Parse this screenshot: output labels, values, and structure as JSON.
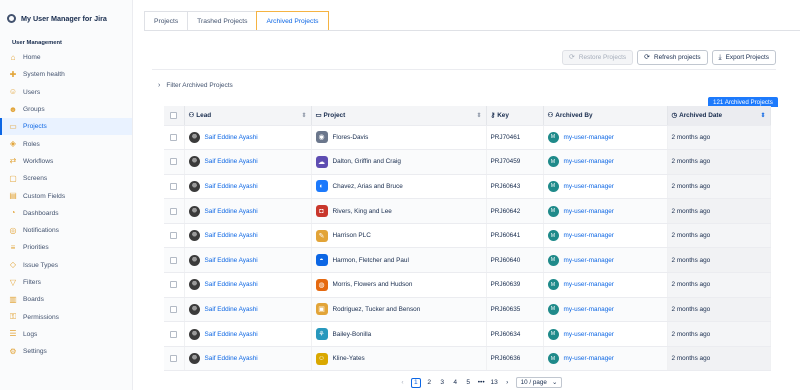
{
  "app": {
    "title": "My User Manager for Jira"
  },
  "sidebar": {
    "section_title": "User Management",
    "items": [
      {
        "label": "Home",
        "icon": "home-icon",
        "glyph": "⌂",
        "name": "home"
      },
      {
        "label": "System health",
        "icon": "health-icon",
        "glyph": "✚",
        "name": "system-health"
      },
      {
        "label": "Users",
        "icon": "user-icon",
        "glyph": "☺",
        "name": "users"
      },
      {
        "label": "Groups",
        "icon": "group-icon",
        "glyph": "☻",
        "name": "groups"
      },
      {
        "label": "Projects",
        "icon": "folder-icon",
        "glyph": "▭",
        "name": "projects",
        "active": true
      },
      {
        "label": "Roles",
        "icon": "role-icon",
        "glyph": "◈",
        "name": "roles"
      },
      {
        "label": "Workflows",
        "icon": "workflow-icon",
        "glyph": "⇄",
        "name": "workflows"
      },
      {
        "label": "Screens",
        "icon": "screen-icon",
        "glyph": "▢",
        "name": "screens"
      },
      {
        "label": "Custom Fields",
        "icon": "fields-icon",
        "glyph": "▤",
        "name": "custom-fields"
      },
      {
        "label": "Dashboards",
        "icon": "dashboard-icon",
        "glyph": "◔",
        "name": "dashboards"
      },
      {
        "label": "Notifications",
        "icon": "bell-icon",
        "glyph": "◎",
        "name": "notifications"
      },
      {
        "label": "Priorities",
        "icon": "priority-icon",
        "glyph": "≡",
        "name": "priorities"
      },
      {
        "label": "Issue Types",
        "icon": "issue-type-icon",
        "glyph": "◇",
        "name": "issue-types"
      },
      {
        "label": "Filters",
        "icon": "filter-icon",
        "glyph": "▽",
        "name": "filters"
      },
      {
        "label": "Boards",
        "icon": "board-icon",
        "glyph": "▥",
        "name": "boards"
      },
      {
        "label": "Permissions",
        "icon": "lock-icon",
        "glyph": "⚿",
        "name": "permissions"
      },
      {
        "label": "Logs",
        "icon": "log-icon",
        "glyph": "☰",
        "name": "logs"
      },
      {
        "label": "Settings",
        "icon": "gear-icon",
        "glyph": "⚙",
        "name": "settings"
      }
    ]
  },
  "tabs": [
    {
      "label": "Projects",
      "active": false
    },
    {
      "label": "Trashed Projects",
      "active": false
    },
    {
      "label": "Archived Projects",
      "active": true
    }
  ],
  "toolbar": {
    "restore_label": "Restore Projects",
    "refresh_label": "Refresh projects",
    "export_label": "Export Projects"
  },
  "filter": {
    "label": "Filter Archived Projects"
  },
  "count_badge": "121 Archived Projects",
  "table": {
    "headers": {
      "lead": "Lead",
      "project": "Project",
      "key": "Key",
      "archived_by": "Archived By",
      "archived_date": "Archived Date"
    },
    "rows": [
      {
        "lead": "Saif Eddine Ayashi",
        "project": "Flores-Davis",
        "key": "PRJ70461",
        "archived_by": "my-user-manager",
        "archived_by_initial": "M",
        "date": "2 months ago",
        "project_color": "#6b778c",
        "project_glyph": "◉"
      },
      {
        "lead": "Saif Eddine Ayashi",
        "project": "Dalton, Griffin and Craig",
        "key": "PRJ70459",
        "archived_by": "my-user-manager",
        "archived_by_initial": "M",
        "date": "2 months ago",
        "project_color": "#5e4db2",
        "project_glyph": "☁"
      },
      {
        "lead": "Saif Eddine Ayashi",
        "project": "Chavez, Arias and Bruce",
        "key": "PRJ60643",
        "archived_by": "my-user-manager",
        "archived_by_initial": "M",
        "date": "2 months ago",
        "project_color": "#1d7afc",
        "project_glyph": "◐"
      },
      {
        "lead": "Saif Eddine Ayashi",
        "project": "Rivers, King and Lee",
        "key": "PRJ60642",
        "archived_by": "my-user-manager",
        "archived_by_initial": "M",
        "date": "2 months ago",
        "project_color": "#c9372c",
        "project_glyph": "◘"
      },
      {
        "lead": "Saif Eddine Ayashi",
        "project": "Harrison PLC",
        "key": "PRJ60641",
        "archived_by": "my-user-manager",
        "archived_by_initial": "M",
        "date": "2 months ago",
        "project_color": "#e2a438",
        "project_glyph": "✎"
      },
      {
        "lead": "Saif Eddine Ayashi",
        "project": "Harmon, Fletcher and Paul",
        "key": "PRJ60640",
        "archived_by": "my-user-manager",
        "archived_by_initial": "M",
        "date": "2 months ago",
        "project_color": "#0c66e4",
        "project_glyph": "◓"
      },
      {
        "lead": "Saif Eddine Ayashi",
        "project": "Morris, Flowers and Hudson",
        "key": "PRJ60639",
        "archived_by": "my-user-manager",
        "archived_by_initial": "M",
        "date": "2 months ago",
        "project_color": "#e56910",
        "project_glyph": "◍"
      },
      {
        "lead": "Saif Eddine Ayashi",
        "project": "Rodriguez, Tucker and Benson",
        "key": "PRJ60635",
        "archived_by": "my-user-manager",
        "archived_by_initial": "M",
        "date": "2 months ago",
        "project_color": "#e2a438",
        "project_glyph": "▣"
      },
      {
        "lead": "Saif Eddine Ayashi",
        "project": "Bailey-Bonilla",
        "key": "PRJ60634",
        "archived_by": "my-user-manager",
        "archived_by_initial": "M",
        "date": "2 months ago",
        "project_color": "#2898bd",
        "project_glyph": "⚘"
      },
      {
        "lead": "Saif Eddine Ayashi",
        "project": "Kline-Yates",
        "key": "PRJ60636",
        "archived_by": "my-user-manager",
        "archived_by_initial": "M",
        "date": "2 months ago",
        "project_color": "#d9a800",
        "project_glyph": "☺"
      }
    ]
  },
  "pagination": {
    "pages": [
      "1",
      "2",
      "3",
      "4",
      "5"
    ],
    "current": "1",
    "ellipsis": "•••",
    "last": "13",
    "per_page": "10 / page"
  }
}
